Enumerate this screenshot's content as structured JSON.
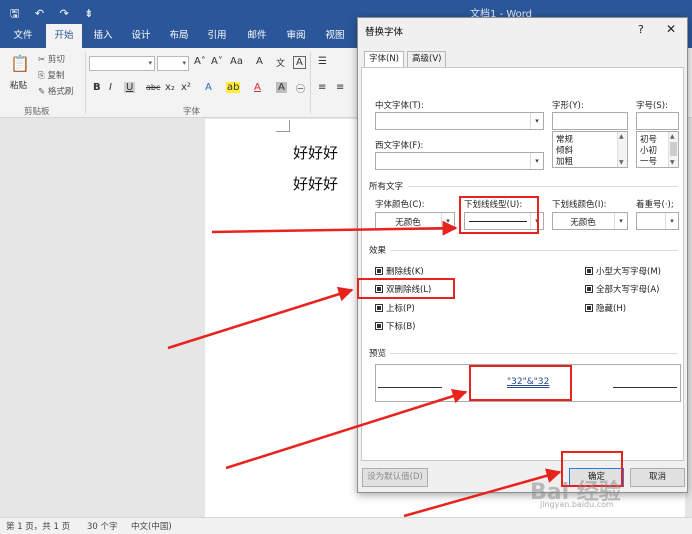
{
  "colors": {
    "word_blue": "#2b579a",
    "highlight_red": "#e8231e",
    "accent": "#2b7bd8"
  },
  "window": {
    "doc_title": "文档1 - Word"
  },
  "quick_access": {
    "save_icon": "save-icon",
    "undo_icon": "undo-icon",
    "redo_icon": "redo-icon"
  },
  "tabs": [
    {
      "label": "文件"
    },
    {
      "label": "开始"
    },
    {
      "label": "插入"
    },
    {
      "label": "设计"
    },
    {
      "label": "布局"
    },
    {
      "label": "引用"
    },
    {
      "label": "邮件"
    },
    {
      "label": "审阅"
    },
    {
      "label": "视图"
    }
  ],
  "ribbon": {
    "clipboard": {
      "paste": "粘贴",
      "cut": "剪切",
      "copy": "复制",
      "format_painter": "格式刷",
      "group_label": "剪贴板"
    },
    "font_group_label": "字体",
    "font_buttons": {
      "bold": "B",
      "italic": "I",
      "underline": "U",
      "strike": "abc",
      "sub": "x₂",
      "sup": "x²",
      "grow": "A˄",
      "shrink": "A˅",
      "case": "Aa",
      "clear": "A",
      "effects": "A",
      "highlight": "ab",
      "color": "A",
      "shading": "A",
      "box": "A"
    }
  },
  "document": {
    "lines": [
      "好好好",
      "好好好"
    ]
  },
  "status": {
    "pages": "第 1 页，共 1 页",
    "words": "30 个字",
    "language": "中文(中国)"
  },
  "dialog": {
    "title": "替换字体",
    "help": "?",
    "close": "✕",
    "tabs": [
      {
        "label": "字体(N)"
      },
      {
        "label": "高级(V)"
      }
    ],
    "labels": {
      "chinese_font": "中文字体(T):",
      "western_font": "西文字体(F):",
      "style": "字形(Y):",
      "size": "字号(S):",
      "all_text": "所有文字",
      "font_color": "字体颜色(C):",
      "underline_type": "下划线线型(U):",
      "underline_color": "下划线颜色(I):",
      "emphasis": "着重号(·);",
      "effects": "效果",
      "preview": "预览"
    },
    "style_options": [
      "常规",
      "倾斜",
      "加粗"
    ],
    "size_options": [
      "初号",
      "小初",
      "一号"
    ],
    "font_color_value": "无颜色",
    "underline_color_value": "无颜色",
    "effects": [
      {
        "label": "删除线(K)"
      },
      {
        "label": "双删除线(L)"
      },
      {
        "label": "上标(P)"
      },
      {
        "label": "下标(B)"
      },
      {
        "label": "小型大写字母(M)"
      },
      {
        "label": "全部大写字母(A)"
      },
      {
        "label": "隐藏(H)"
      }
    ],
    "preview_text": "\"32\"&\"32",
    "buttons": {
      "set_default": "设为默认值(D)",
      "ok": "确定",
      "cancel": "取消"
    }
  },
  "watermark": {
    "main": "Bai 经验",
    "sub": "jingyan.baidu.com"
  }
}
